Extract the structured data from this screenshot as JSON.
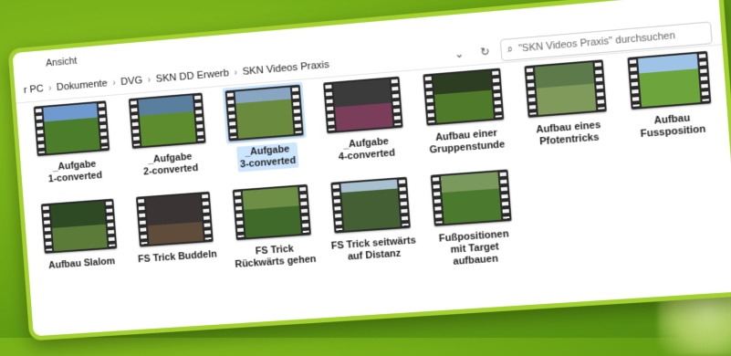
{
  "window": {
    "view_menu": "Ansicht",
    "address": [
      "r PC",
      "Dokumente",
      "DVG",
      "SKN DD Erwerb",
      "SKN Videos Praxis"
    ],
    "search_placeholder": "\"SKN Videos Praxis\" durchsuchen"
  },
  "files": [
    {
      "name": "_Aufgabe\n1-converted",
      "scene": "woman-lawn"
    },
    {
      "name": "_Aufgabe\n2-converted",
      "scene": "dog-lawn"
    },
    {
      "name": "_Aufgabe\n3-converted",
      "scene": "person-yard",
      "selected": true
    },
    {
      "name": "_Aufgabe\n4-converted",
      "scene": "woman-indoor"
    },
    {
      "name": "Aufbau einer\nGruppenstunde",
      "scene": "group-field"
    },
    {
      "name": "Aufbau eines\nPfotentricks",
      "scene": "people-field"
    },
    {
      "name": "Aufbau\nFussposition",
      "scene": "open-field"
    },
    {
      "name": "Aufbau Slalom",
      "scene": "hedge-yard"
    },
    {
      "name": "FS Trick Buddeln",
      "scene": "dark-indoor"
    },
    {
      "name": "FS Trick\nRückwärts gehen",
      "scene": "grass"
    },
    {
      "name": "FS Trick seitwärts\nauf Distanz",
      "scene": "trees"
    },
    {
      "name": "Fußpositionen\nmit Target\naufbauen",
      "scene": "green-yard"
    }
  ]
}
